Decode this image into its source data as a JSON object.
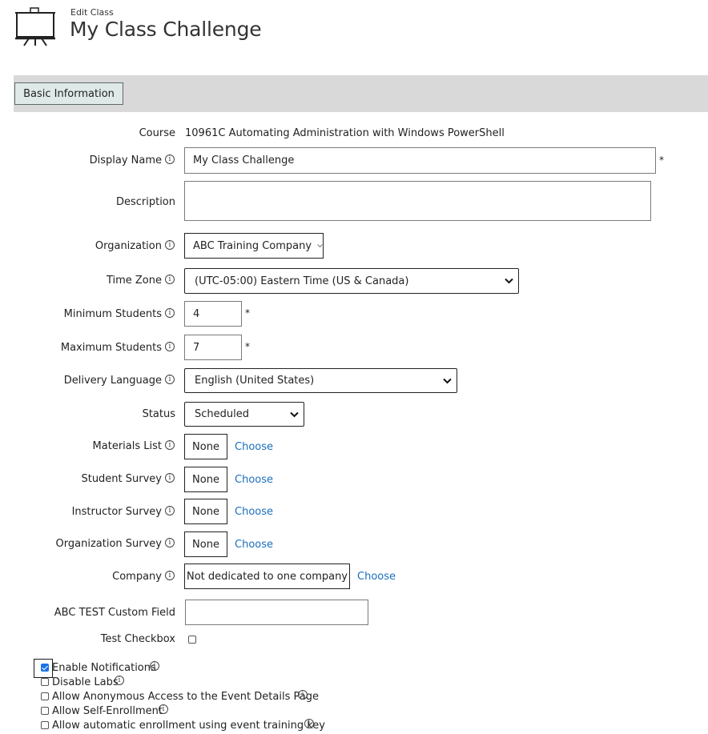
{
  "header": {
    "subtitle": "Edit Class",
    "title": "My Class Challenge",
    "icon": "presentation-board-icon"
  },
  "tabs": [
    {
      "label": "Basic Information",
      "active": true
    }
  ],
  "form": {
    "course": {
      "label": "Course",
      "value": "10961C Automating Administration with Windows PowerShell"
    },
    "display_name": {
      "label": "Display Name",
      "value": "My Class Challenge",
      "required": "*"
    },
    "description": {
      "label": "Description",
      "value": ""
    },
    "organization": {
      "label": "Organization",
      "value": "ABC Training Company"
    },
    "time_zone": {
      "label": "Time Zone",
      "value": "(UTC-05:00) Eastern Time (US & Canada)"
    },
    "min_students": {
      "label": "Minimum Students",
      "value": "4",
      "required": "*"
    },
    "max_students": {
      "label": "Maximum Students",
      "value": "7",
      "required": "*"
    },
    "delivery_language": {
      "label": "Delivery Language",
      "value": "English (United States)"
    },
    "status": {
      "label": "Status",
      "value": "Scheduled"
    },
    "materials_list": {
      "label": "Materials List",
      "value": "None",
      "action": "Choose"
    },
    "student_survey": {
      "label": "Student Survey",
      "value": "None",
      "action": "Choose"
    },
    "instructor_survey": {
      "label": "Instructor Survey",
      "value": "None",
      "action": "Choose"
    },
    "organization_survey": {
      "label": "Organization Survey",
      "value": "None",
      "action": "Choose"
    },
    "company": {
      "label": "Company",
      "value": "Not dedicated to one company",
      "action": "Choose"
    },
    "custom_field": {
      "label": "ABC TEST Custom Field",
      "value": ""
    },
    "test_checkbox": {
      "label": "Test Checkbox",
      "checked": false
    }
  },
  "options": [
    {
      "label": "Enable Notifications",
      "checked": true,
      "info": true
    },
    {
      "label": "Disable Labs",
      "checked": false,
      "info": true
    },
    {
      "label": "Allow Anonymous Access to the Event Details Page",
      "checked": false,
      "info": true
    },
    {
      "label": "Allow Self-Enrollment",
      "checked": false,
      "info": true
    },
    {
      "label": "Allow automatic enrollment using event training key",
      "checked": false,
      "info": true
    }
  ],
  "info_glyph": "i",
  "colors": {
    "tab_strip": "#d9d9d9",
    "tab_active": "#dfe9e7",
    "link": "#1a6fbf",
    "checkbox_checked": "#1a73e8"
  }
}
